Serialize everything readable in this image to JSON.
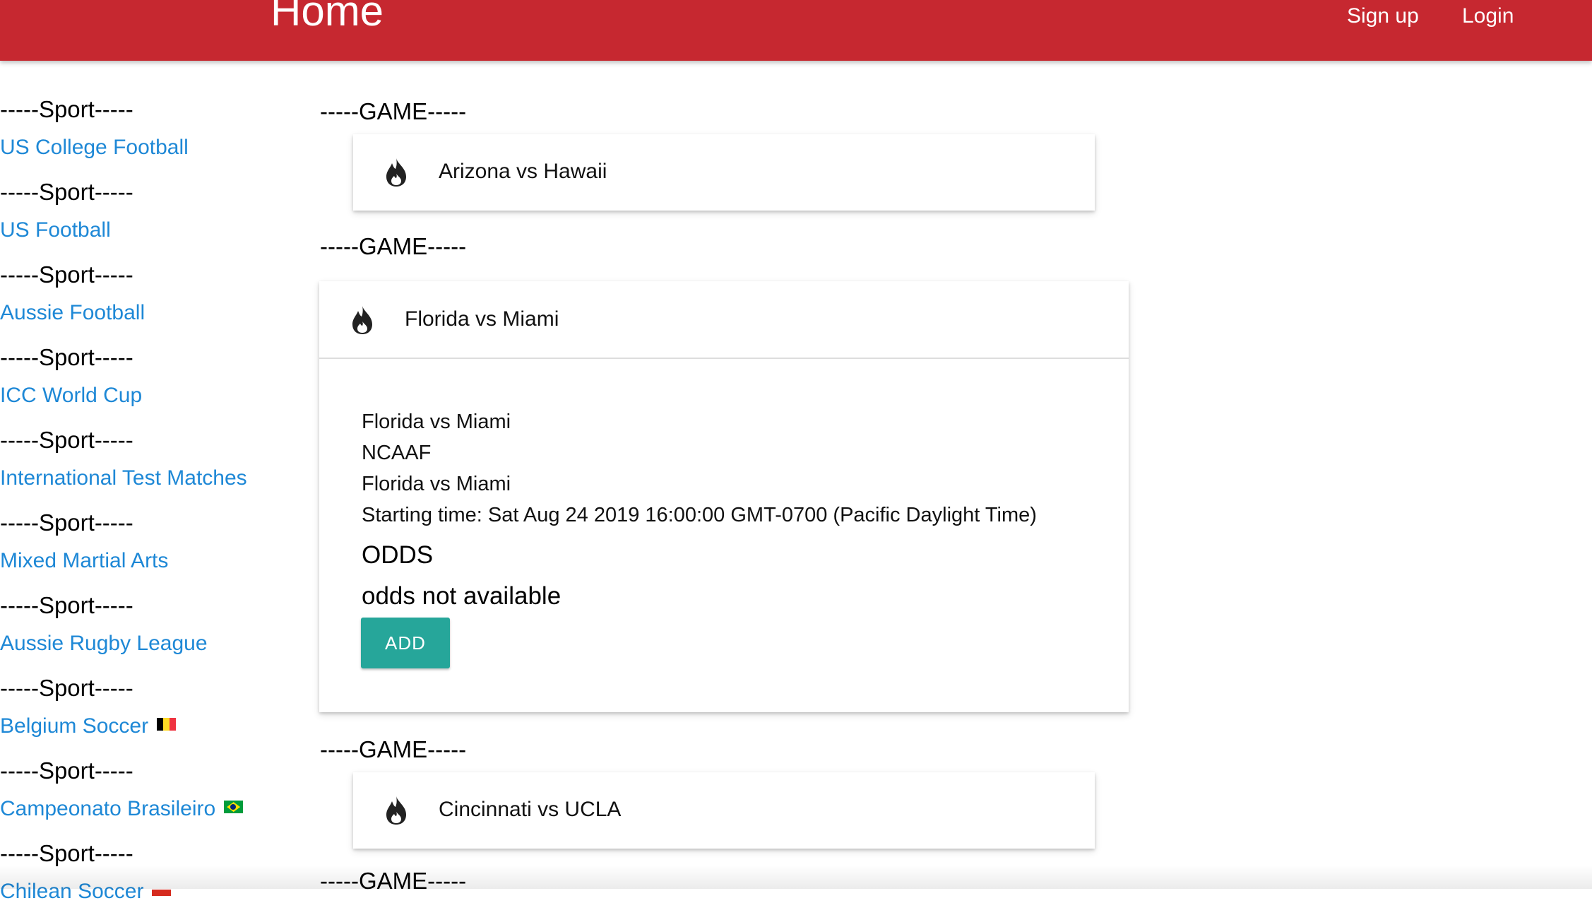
{
  "navbar": {
    "brand": "Home",
    "links": [
      "Sign up",
      "Login"
    ]
  },
  "colors": {
    "navbar_bg": "#c62830",
    "link": "#1e88d6",
    "add_button": "#26a69a"
  },
  "sidebar": {
    "separator": "-----Sport-----",
    "items": [
      {
        "label": "US College Football"
      },
      {
        "label": "US Football"
      },
      {
        "label": "Aussie Football"
      },
      {
        "label": "ICC World Cup"
      },
      {
        "label": "International Test Matches"
      },
      {
        "label": "Mixed Martial Arts"
      },
      {
        "label": "Aussie Rugby League"
      },
      {
        "label": "Belgium Soccer",
        "icon": "belgium-flag-icon"
      },
      {
        "label": "Campeonato Brasileiro",
        "icon": "brazil-flag-icon"
      },
      {
        "label": "Chilean Soccer",
        "icon": "chile-flag-icon"
      }
    ]
  },
  "games": {
    "separator": "-----GAME-----",
    "icon": "fire-icon",
    "cards": [
      {
        "title": "Arizona vs Hawaii",
        "expanded": false
      },
      {
        "title": "Florida vs Miami",
        "expanded": true,
        "details": [
          "Florida vs Miami",
          "NCAAF",
          "Florida vs Miami",
          "Starting time: Sat Aug 24 2019 16:00:00 GMT-0700 (Pacific Daylight Time)"
        ],
        "odds_title": "ODDS",
        "odds_text": "odds not available",
        "add_label": "ADD"
      },
      {
        "title": "Cincinnati vs UCLA",
        "expanded": false
      }
    ]
  }
}
